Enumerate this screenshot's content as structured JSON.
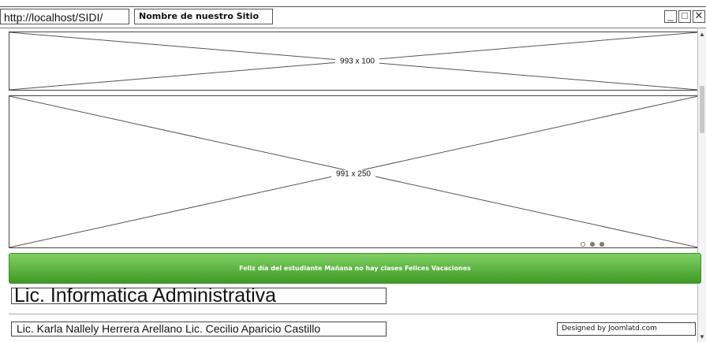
{
  "window": {
    "url": "http://localhost/SIDI/",
    "site_name": "Nombre de nuestro Sitio",
    "controls": {
      "minimize": "_",
      "maximize": "□",
      "close": "✕"
    }
  },
  "header_placeholder": {
    "label": "993 x 100"
  },
  "slider_placeholder": {
    "label": "991 x 250",
    "slide_count": 3,
    "active_slide": 1
  },
  "announcement": {
    "text": "Feliz día del estudiante Mañana no hay clases Felices Vacaciones",
    "color": "#4fae33"
  },
  "main": {
    "heading": "Lic. Informatica Administrativa"
  },
  "footer": {
    "authors": "Lic. Karla Nallely Herrera Arellano Lic. Cecilio Aparicio Castillo",
    "credit": "Designed by Joomlatd.com"
  }
}
